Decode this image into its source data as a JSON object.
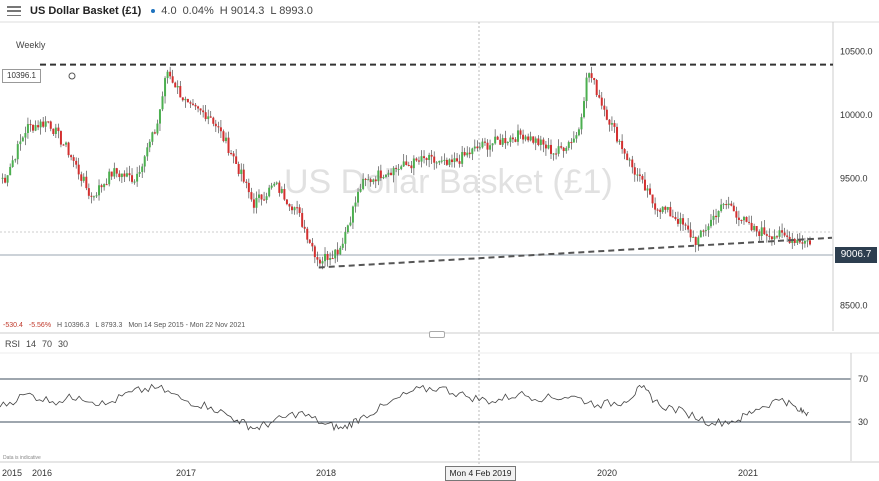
{
  "toolbar": {
    "instrument": "US Dollar Basket (£1)",
    "change": "4.0",
    "change_pct": "0.04%",
    "high": "H 9014.3",
    "low": "L 8993.0"
  },
  "interval": "Weekly",
  "watermark": "US Dollar Basket (£1)",
  "price_axis": {
    "ticks": [
      "10500.0",
      "10000.0",
      "9500.0",
      "8500.0"
    ],
    "current_price": "9006.7",
    "hline_label": "10396.1"
  },
  "stats_bar": {
    "change": "-530.4",
    "change_pct": "-5.56%",
    "high": "H 10396.3",
    "low": "L 8793.3",
    "range": "Mon 14 Sep 2015 - Mon 22 Nov 2021"
  },
  "rsi": {
    "name": "RSI",
    "period": "14",
    "upper": "70",
    "lower": "30",
    "upper_tick": "70",
    "lower_tick": "30"
  },
  "time_axis": {
    "labels": [
      "2015",
      "2016",
      "2017",
      "2018",
      "2020",
      "2021"
    ],
    "cursor_date": "Mon 4 Feb 2019"
  },
  "source_note": "Data is indicative",
  "colors": {
    "up": "#4caf50",
    "down": "#d32f2f",
    "wick": "#333333",
    "price_tag": "#2d3e4f",
    "rsi_line": "#444444",
    "rsi_oversold": "#4caf50"
  },
  "chart_data": {
    "type": "candlestick",
    "title": "US Dollar Basket (£1)",
    "interval": "Weekly",
    "ylim": [
      8300,
      10700
    ],
    "y_ticks": [
      10500,
      10000,
      9500,
      8500
    ],
    "x_labels": [
      "2015",
      "2016",
      "2017",
      "2018",
      "Mon 4 Feb 2019",
      "2020",
      "2021"
    ],
    "series": [
      {
        "name": "US Dollar Basket (£1)",
        "close_anchors": [
          [
            "2015-09",
            9500
          ],
          [
            "2015-11",
            9900
          ],
          [
            "2016-01",
            9950
          ],
          [
            "2016-03",
            9700
          ],
          [
            "2016-05",
            9350
          ],
          [
            "2016-07",
            9550
          ],
          [
            "2016-09",
            9500
          ],
          [
            "2016-11",
            9900
          ],
          [
            "2016-12",
            10350
          ],
          [
            "2017-02",
            10050
          ],
          [
            "2017-04",
            10000
          ],
          [
            "2017-06",
            9700
          ],
          [
            "2017-08",
            9300
          ],
          [
            "2017-10",
            9450
          ],
          [
            "2017-12",
            9250
          ],
          [
            "2018-02",
            8850
          ],
          [
            "2018-04",
            8950
          ],
          [
            "2018-06",
            9450
          ],
          [
            "2018-08",
            9550
          ],
          [
            "2018-10",
            9600
          ],
          [
            "2018-12",
            9650
          ],
          [
            "2019-02",
            9600
          ],
          [
            "2019-05",
            9750
          ],
          [
            "2019-09",
            9850
          ],
          [
            "2019-12",
            9700
          ],
          [
            "2020-02",
            9850
          ],
          [
            "2020-03",
            10350
          ],
          [
            "2020-05",
            9950
          ],
          [
            "2020-07",
            9600
          ],
          [
            "2020-09",
            9300
          ],
          [
            "2020-11",
            9200
          ],
          [
            "2021-01",
            9000
          ],
          [
            "2021-03",
            9250
          ],
          [
            "2021-04",
            9300
          ],
          [
            "2021-06",
            9100
          ],
          [
            "2021-11",
            9006.7
          ]
        ]
      }
    ],
    "horizontal_line": 10396.1,
    "trend_line": [
      [
        "2018-02",
        8800
      ],
      [
        "2021-11",
        9010
      ]
    ],
    "rsi": {
      "period": 14,
      "ylim": [
        0,
        100
      ],
      "levels": [
        70,
        30
      ],
      "points": [
        [
          0,
          50
        ],
        [
          0.03,
          62
        ],
        [
          0.06,
          55
        ],
        [
          0.09,
          60
        ],
        [
          0.12,
          52
        ],
        [
          0.15,
          64
        ],
        [
          0.18,
          68
        ],
        [
          0.21,
          56
        ],
        [
          0.24,
          50
        ],
        [
          0.27,
          38
        ],
        [
          0.29,
          30
        ],
        [
          0.31,
          36
        ],
        [
          0.34,
          45
        ],
        [
          0.37,
          34
        ],
        [
          0.39,
          30
        ],
        [
          0.41,
          40
        ],
        [
          0.44,
          52
        ],
        [
          0.47,
          65
        ],
        [
          0.5,
          68
        ],
        [
          0.53,
          60
        ],
        [
          0.56,
          55
        ],
        [
          0.59,
          62
        ],
        [
          0.62,
          58
        ],
        [
          0.65,
          60
        ],
        [
          0.68,
          52
        ],
        [
          0.71,
          55
        ],
        [
          0.73,
          68
        ],
        [
          0.75,
          52
        ],
        [
          0.78,
          45
        ],
        [
          0.81,
          35
        ],
        [
          0.84,
          38
        ],
        [
          0.86,
          48
        ],
        [
          0.89,
          58
        ],
        [
          0.91,
          46
        ],
        [
          0.92,
          45
        ]
      ]
    }
  }
}
